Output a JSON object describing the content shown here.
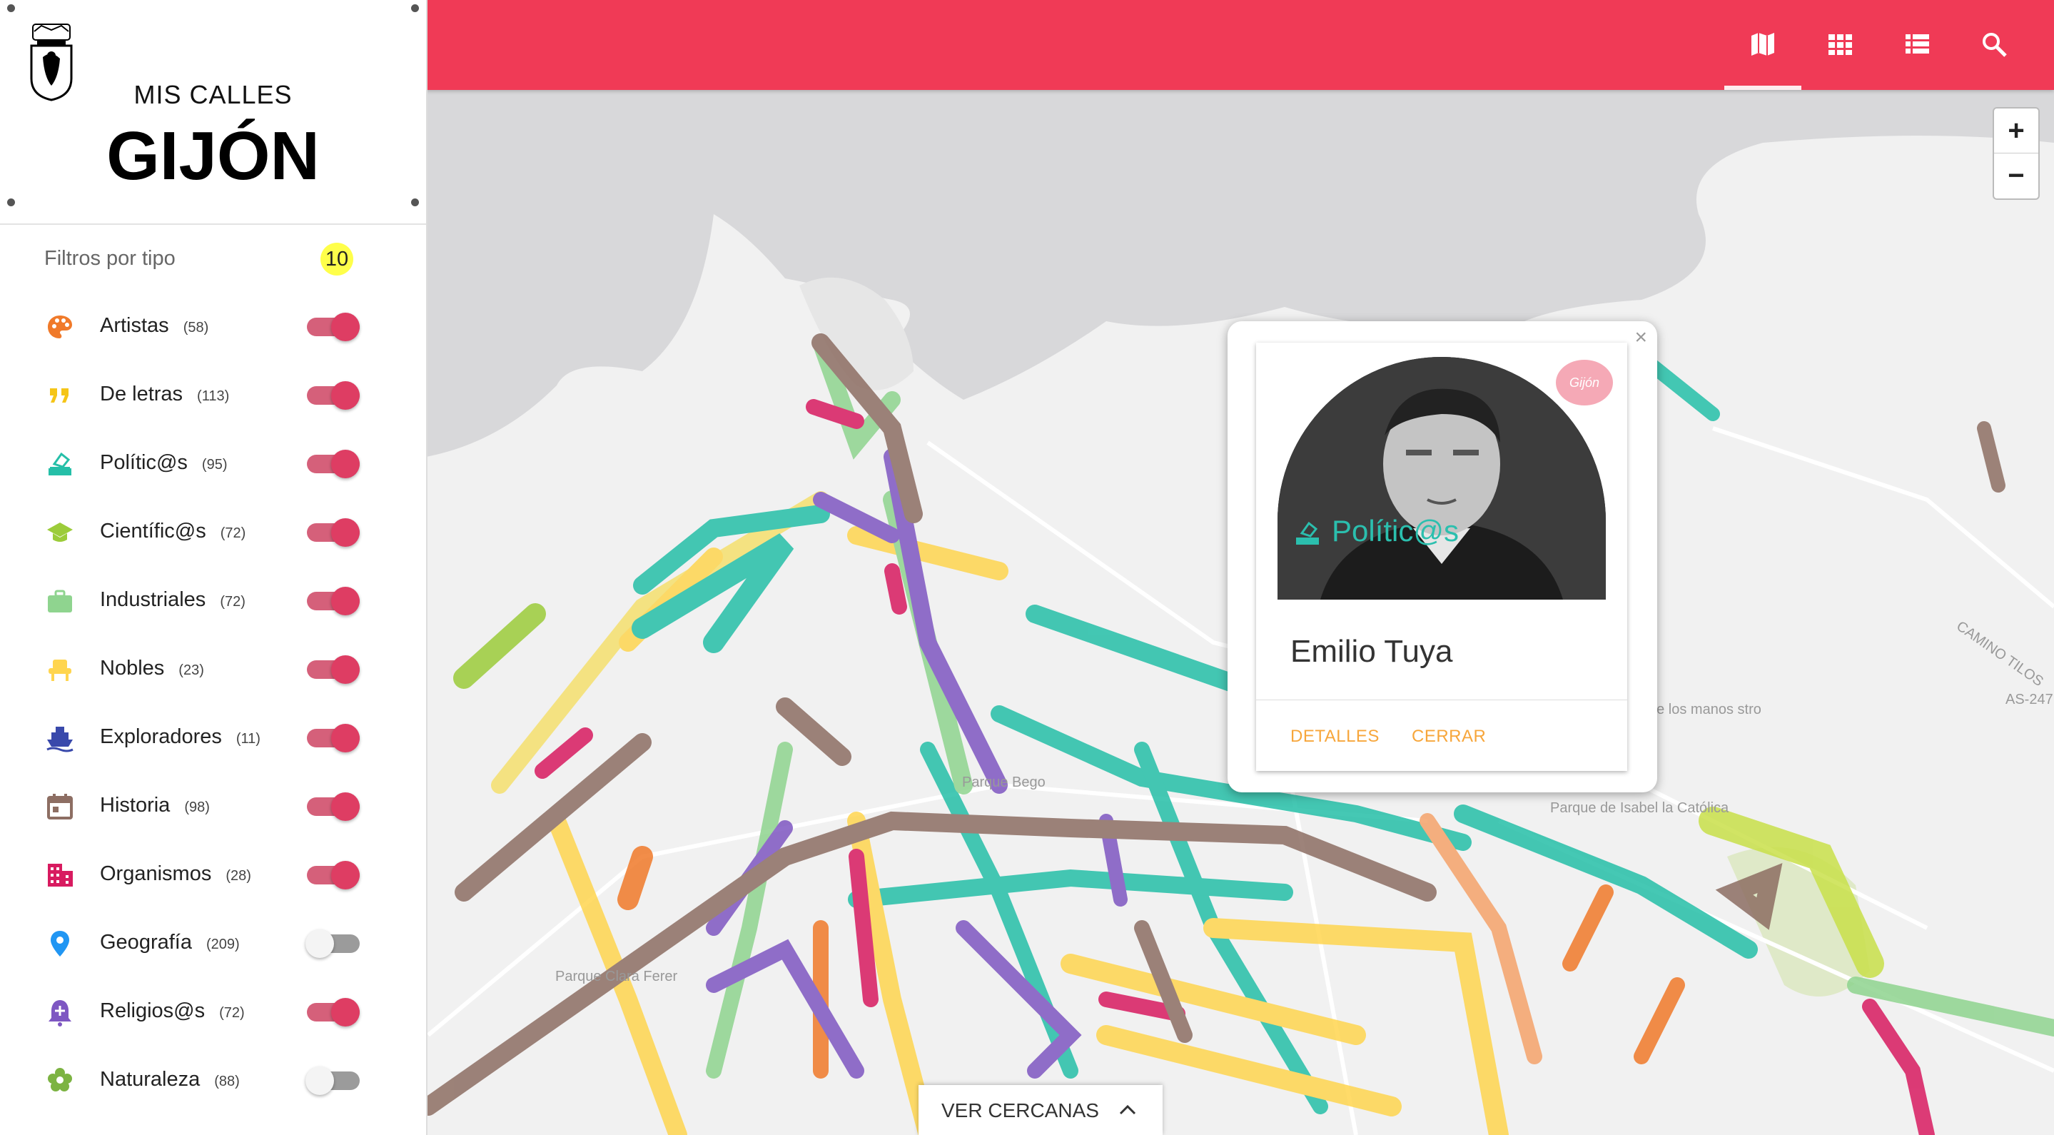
{
  "brand": {
    "small": "MIS CALLES",
    "big": "GIJÓN"
  },
  "filters": {
    "header": "Filtros por tipo",
    "active_count": "10",
    "items": [
      {
        "label": "Artistas",
        "count": "(58)",
        "on": true,
        "icon": "palette-icon",
        "color": "#f07a2a"
      },
      {
        "label": "De letras",
        "count": "(113)",
        "on": true,
        "icon": "quote-icon",
        "color": "#f5c518"
      },
      {
        "label": "Polític@s",
        "count": "(95)",
        "on": true,
        "icon": "ballot-icon",
        "color": "#25bfa8"
      },
      {
        "label": "Científic@s",
        "count": "(72)",
        "on": true,
        "icon": "graduation-cap-icon",
        "color": "#9ccc3a"
      },
      {
        "label": "Industriales",
        "count": "(72)",
        "on": true,
        "icon": "briefcase-icon",
        "color": "#8fd48f"
      },
      {
        "label": "Nobles",
        "count": "(23)",
        "on": true,
        "icon": "throne-icon",
        "color": "#ffd54f"
      },
      {
        "label": "Exploradores",
        "count": "(11)",
        "on": true,
        "icon": "ship-icon",
        "color": "#3949ab"
      },
      {
        "label": "Historia",
        "count": "(98)",
        "on": true,
        "icon": "calendar-icon",
        "color": "#8d6e63"
      },
      {
        "label": "Organismos",
        "count": "(28)",
        "on": true,
        "icon": "building-icon",
        "color": "#d81b60"
      },
      {
        "label": "Geografía",
        "count": "(209)",
        "on": false,
        "icon": "map-pin-icon",
        "color": "#2196f3"
      },
      {
        "label": "Religios@s",
        "count": "(72)",
        "on": true,
        "icon": "bell-icon",
        "color": "#7e57c2"
      },
      {
        "label": "Naturaleza",
        "count": "(88)",
        "on": false,
        "icon": "flower-icon",
        "color": "#7cb342"
      }
    ]
  },
  "toolbar": {
    "buttons": [
      "map-icon",
      "grid-icon",
      "list-icon",
      "search-icon"
    ],
    "active": "map-icon"
  },
  "map_labels": {
    "parque_begona": "Parque Bego",
    "parque_clara": "Parque Clara Ferer",
    "parque_isabel": "Parque de Isabel la Católica",
    "hermanos": "de los manos stro",
    "camino": "CAMINO TILOS",
    "as247": "AS-247"
  },
  "popup": {
    "category": "Polític@s",
    "name": "Emilio Tuya",
    "stamp": "Gijón",
    "details_label": "DETALLES",
    "close_label": "CERRAR"
  },
  "zoom": {
    "in": "+",
    "out": "−"
  },
  "nearby": {
    "label": "VER CERCANAS"
  }
}
